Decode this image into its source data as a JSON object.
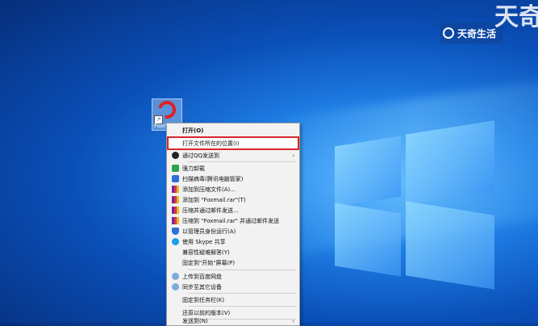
{
  "watermark": {
    "brand": "天奇生活",
    "corner": "天奇"
  },
  "desktop_icon": {
    "label": "Foxmail"
  },
  "context_menu": {
    "items": [
      {
        "label": "打开(O)",
        "icon": "",
        "bold": true
      },
      {
        "label": "打开文件所在的位置(I)",
        "icon": "",
        "highlighted": true
      },
      {
        "label": "通过QQ发送到",
        "icon": "qq-icon",
        "submenu": true
      },
      {
        "label": "强力卸载",
        "icon": "uninstall-icon"
      },
      {
        "label": "扫描病毒(腾讯电脑管家)",
        "icon": "scan-icon"
      },
      {
        "label": "添加到压缩文件(A)...",
        "icon": "winrar-icon"
      },
      {
        "label": "添加到 \"Foxmail.rar\"(T)",
        "icon": "winrar-icon"
      },
      {
        "label": "压缩并通过邮件发送...",
        "icon": "winrar-icon"
      },
      {
        "label": "压缩到 \"Foxmail.rar\" 并通过邮件发送",
        "icon": "winrar-icon"
      },
      {
        "label": "以管理员身份运行(A)",
        "icon": "shield-icon"
      },
      {
        "label": "使用 Skype 共享",
        "icon": "skype-icon"
      },
      {
        "label": "兼容性疑难解答(Y)",
        "icon": ""
      },
      {
        "label": "固定到\"开始\"屏幕(P)",
        "icon": ""
      },
      {
        "label": "上传到百度网盘",
        "icon": "cloud-icon"
      },
      {
        "label": "同步至其它设备",
        "icon": "sync-icon"
      },
      {
        "label": "固定到任务栏(K)",
        "icon": ""
      },
      {
        "label": "还原以前的版本(V)",
        "icon": ""
      },
      {
        "label": "发送到(N)",
        "icon": "",
        "submenu": true
      }
    ],
    "submenu_arrow": "›"
  }
}
